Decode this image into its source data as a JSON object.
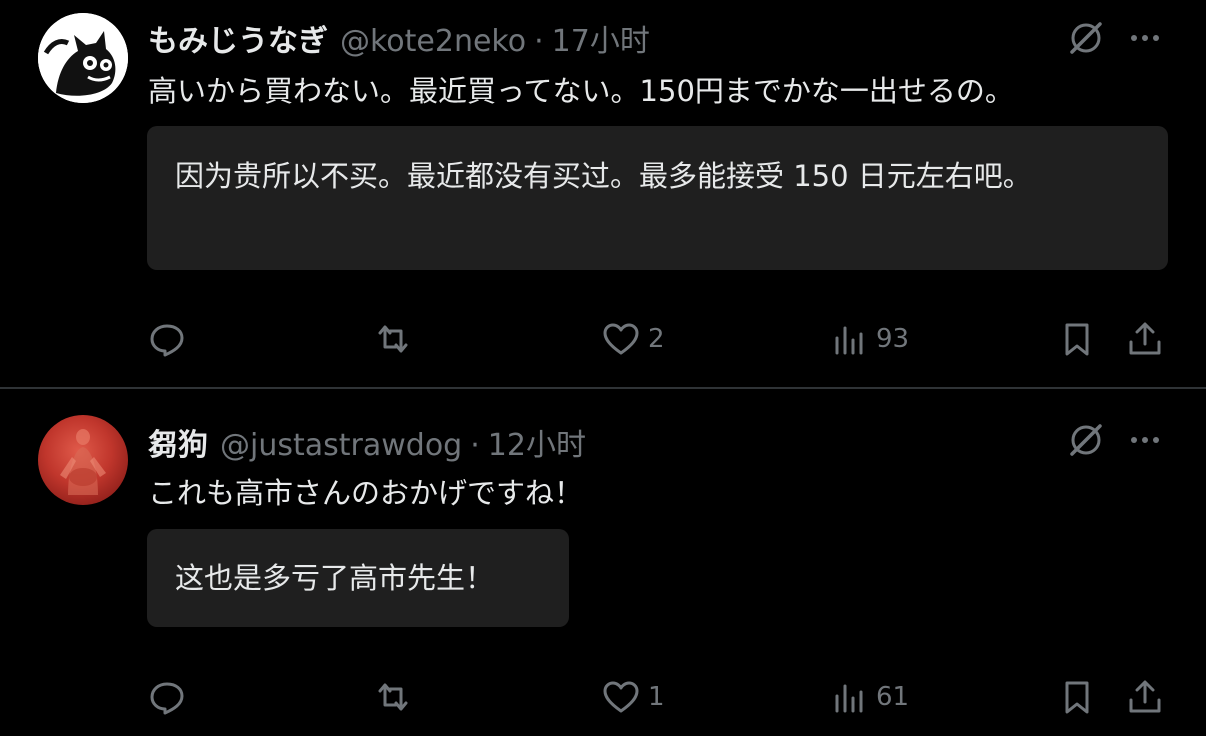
{
  "tweets": [
    {
      "display_name": "もみじうなぎ",
      "handle": "@kote2neko",
      "separator": "·",
      "time": "17小时",
      "text": "高いから買わない。最近買ってない。150円までかな一出せるの。",
      "translation": "因为贵所以不买。最近都没有买过。最多能接受 150 日元左右吧。",
      "likes": "2",
      "views": "93"
    },
    {
      "display_name": "芻狗",
      "handle": "@justastrawdog",
      "separator": "·",
      "time": "12小时",
      "text": "これも高市さんのおかげですね！",
      "translation": "这也是多亏了高市先生！",
      "likes": "1",
      "views": "61"
    }
  ],
  "icons": {
    "avatar_1": "cat-avatar-icon",
    "avatar_2": "statue-avatar-icon",
    "grok": "grok-icon",
    "more": "more-icon",
    "reply": "reply-icon",
    "retweet": "retweet-icon",
    "like": "heart-icon",
    "views": "views-icon",
    "bookmark": "bookmark-icon",
    "share": "share-icon"
  },
  "colors": {
    "background": "#000000",
    "text": "#e7e9ea",
    "muted": "#71767b",
    "translation_bg": "#1f1f1f",
    "divider": "#2f3336"
  }
}
